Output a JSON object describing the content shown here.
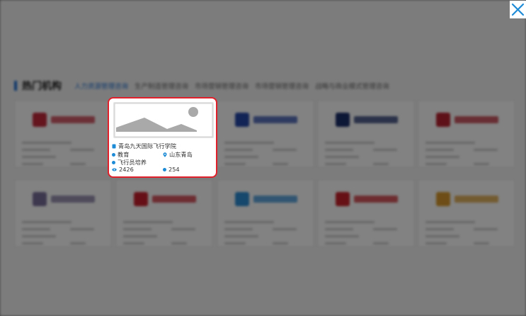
{
  "section": {
    "title": "热门机构",
    "tabs": [
      "人力资源管理咨询",
      "生产制造管理咨询",
      "市场营销管理咨询",
      "市场营销管理咨询",
      "战略与商业模式管理咨询"
    ],
    "active_tab": 0
  },
  "background_cards": [
    {
      "logo_color": "#c42a3b"
    },
    {
      "logo_color": "#1b2f6a"
    },
    {
      "logo_color": "#b92330"
    },
    {
      "logo_color": "#7a6f9a"
    },
    {
      "logo_color": "#c81f2c"
    },
    {
      "logo_color": "#2b8bd4"
    },
    {
      "logo_color": "#c8222a"
    },
    {
      "logo_color": "#d89a2c"
    },
    {
      "logo_color": "#2446a8"
    }
  ],
  "highlight_card": {
    "name": "青岛九天国际飞行学院",
    "category": "教育",
    "location": "山东青岛",
    "service": "飞行员培养",
    "views": "2426",
    "likes": "254"
  },
  "colors": {
    "accent": "#1e6fd1",
    "highlight_border": "#e0202a",
    "close_icon": "#1e8bd6",
    "icon_blue": "#1e8bd6"
  },
  "icons": {
    "close": "close-icon",
    "image_placeholder": "image-placeholder-icon",
    "location": "location-pin-icon",
    "views": "eye-icon"
  }
}
